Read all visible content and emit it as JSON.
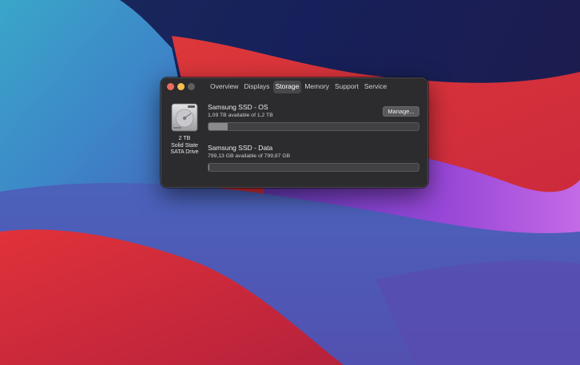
{
  "window": {
    "tabs": [
      {
        "label": "Overview",
        "active": false
      },
      {
        "label": "Displays",
        "active": false
      },
      {
        "label": "Storage",
        "active": true
      },
      {
        "label": "Memory",
        "active": false
      },
      {
        "label": "Support",
        "active": false
      },
      {
        "label": "Service",
        "active": false
      }
    ]
  },
  "drive": {
    "icon": "hard-drive-icon",
    "capacity": "2 TB",
    "type_line1": "Solid State",
    "type_line2": "SATA Drive"
  },
  "volumes": [
    {
      "name": "Samsung SSD - OS",
      "available": "1,09 TB available of 1,2 TB",
      "used_fraction": 0.09
    },
    {
      "name": "Samsung SSD - Data",
      "available": "799,13 GB available of 799,87 GB",
      "used_fraction": 0.001
    }
  ],
  "manage_button": {
    "label": "Manage..."
  },
  "colors": {
    "close": "#ed6a5e",
    "minimize": "#f5bf4f",
    "zoom_disabled": "#5f5e61",
    "active_tab": "#48474a",
    "bar_fill": "#8a898c"
  }
}
